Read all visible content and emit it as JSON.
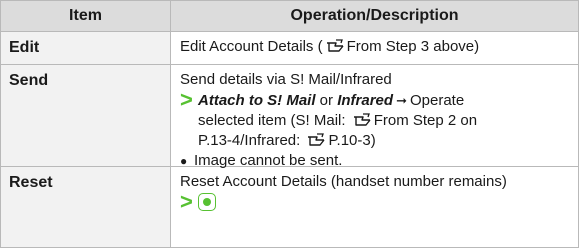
{
  "header": {
    "item": "Item",
    "operation": "Operation/Description"
  },
  "rows": [
    {
      "item": "Edit",
      "desc_before": "Edit Account Details (",
      "desc_ref": "From Step 3 above)"
    },
    {
      "item": "Send",
      "line1": "Send details via S! Mail/Infrared",
      "opt1": "Attach to S! Mail",
      "or_text": " or ",
      "opt2": "Infrared",
      "after_arrow": "Operate",
      "line3_a": "selected item (S! Mail: ",
      "line3_b": "From Step 2 on",
      "line4_a": "P.13-4/Infrared: ",
      "line4_b": "P.10-3)",
      "note": "Image cannot be sent."
    },
    {
      "item": "Reset",
      "line1": "Reset Account Details (handset number remains)"
    }
  ],
  "colors": {
    "accent_green": "#57c132",
    "header_bg": "#dcdcdc",
    "item_bg": "#f2f2f2",
    "border": "#b9b9b9"
  },
  "icons": [
    "reference-hand-icon",
    "right-arrow-icon",
    "center-key-icon",
    "green-chevron-icon"
  ]
}
